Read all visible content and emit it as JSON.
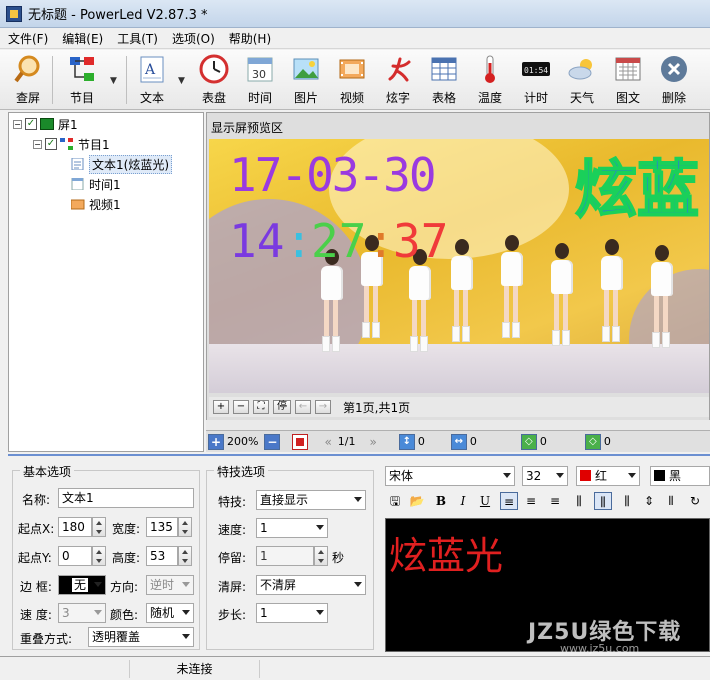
{
  "window": {
    "title": "无标题 - PowerLed V2.87.3 *"
  },
  "menu": [
    "文件(F)",
    "编辑(E)",
    "工具(T)",
    "选项(O)",
    "帮助(H)"
  ],
  "toolbar": {
    "check": "查屏",
    "program": "节目",
    "text": "文本",
    "clock": "表盘",
    "time": "时间",
    "picture": "图片",
    "video": "视频",
    "fancy": "炫字",
    "table": "表格",
    "temperature": "温度",
    "timer": "计时",
    "weather": "天气",
    "imagetext": "图文",
    "delete": "删除"
  },
  "tree": {
    "screen": "屏1",
    "program": "节目1",
    "text": "文本1(炫蓝光)",
    "time": "时间1",
    "video": "视频1"
  },
  "preview": {
    "title": "显示屏预览区",
    "date": "17-03-30",
    "time_hh": "14",
    "time_mm": "27",
    "time_ss": "37",
    "marquee": "炫蓝",
    "page_info": "第1页,共1页"
  },
  "statusrow": {
    "zoom": "200%",
    "page": "1/1",
    "v1": "0",
    "v2": "0",
    "v3": "0",
    "v4": "0"
  },
  "basic": {
    "title": "基本选项",
    "name_label": "名称:",
    "name_value": "文本1",
    "x_label": "起点X:",
    "x_value": "180",
    "width_label": "宽度:",
    "width_value": "135",
    "y_label": "起点Y:",
    "y_value": "0",
    "height_label": "高度:",
    "height_value": "53",
    "border_label": "边 框:",
    "border_value": "无",
    "direction_label": "方向:",
    "direction_value": "逆时",
    "speed_label": "速 度:",
    "speed_value": "3",
    "color_label": "颜色:",
    "color_value": "随机",
    "overlay_label": "重叠方式:",
    "overlay_value": "透明覆盖"
  },
  "effect": {
    "title": "特技选项",
    "effect_label": "特技:",
    "effect_value": "直接显示",
    "speed_label": "速度:",
    "speed_value": "1",
    "stay_label": "停留:",
    "stay_value": "1",
    "stay_unit": "秒",
    "clear_label": "清屏:",
    "clear_value": "不清屏",
    "step_label": "步长:",
    "step_value": "1"
  },
  "font": {
    "family": "宋体",
    "size": "32",
    "color_fg": "红",
    "color_bg": "黑",
    "fg_hex": "#e00000",
    "bg_hex": "#000000"
  },
  "formatting": {
    "bold": "B",
    "italic": "I",
    "underline": "U"
  },
  "editor": {
    "content": "炫蓝光"
  },
  "status": {
    "connection": "未连接"
  },
  "watermark": {
    "line1": "JZ5U绿色下载",
    "line2": "www.jz5u.com"
  }
}
